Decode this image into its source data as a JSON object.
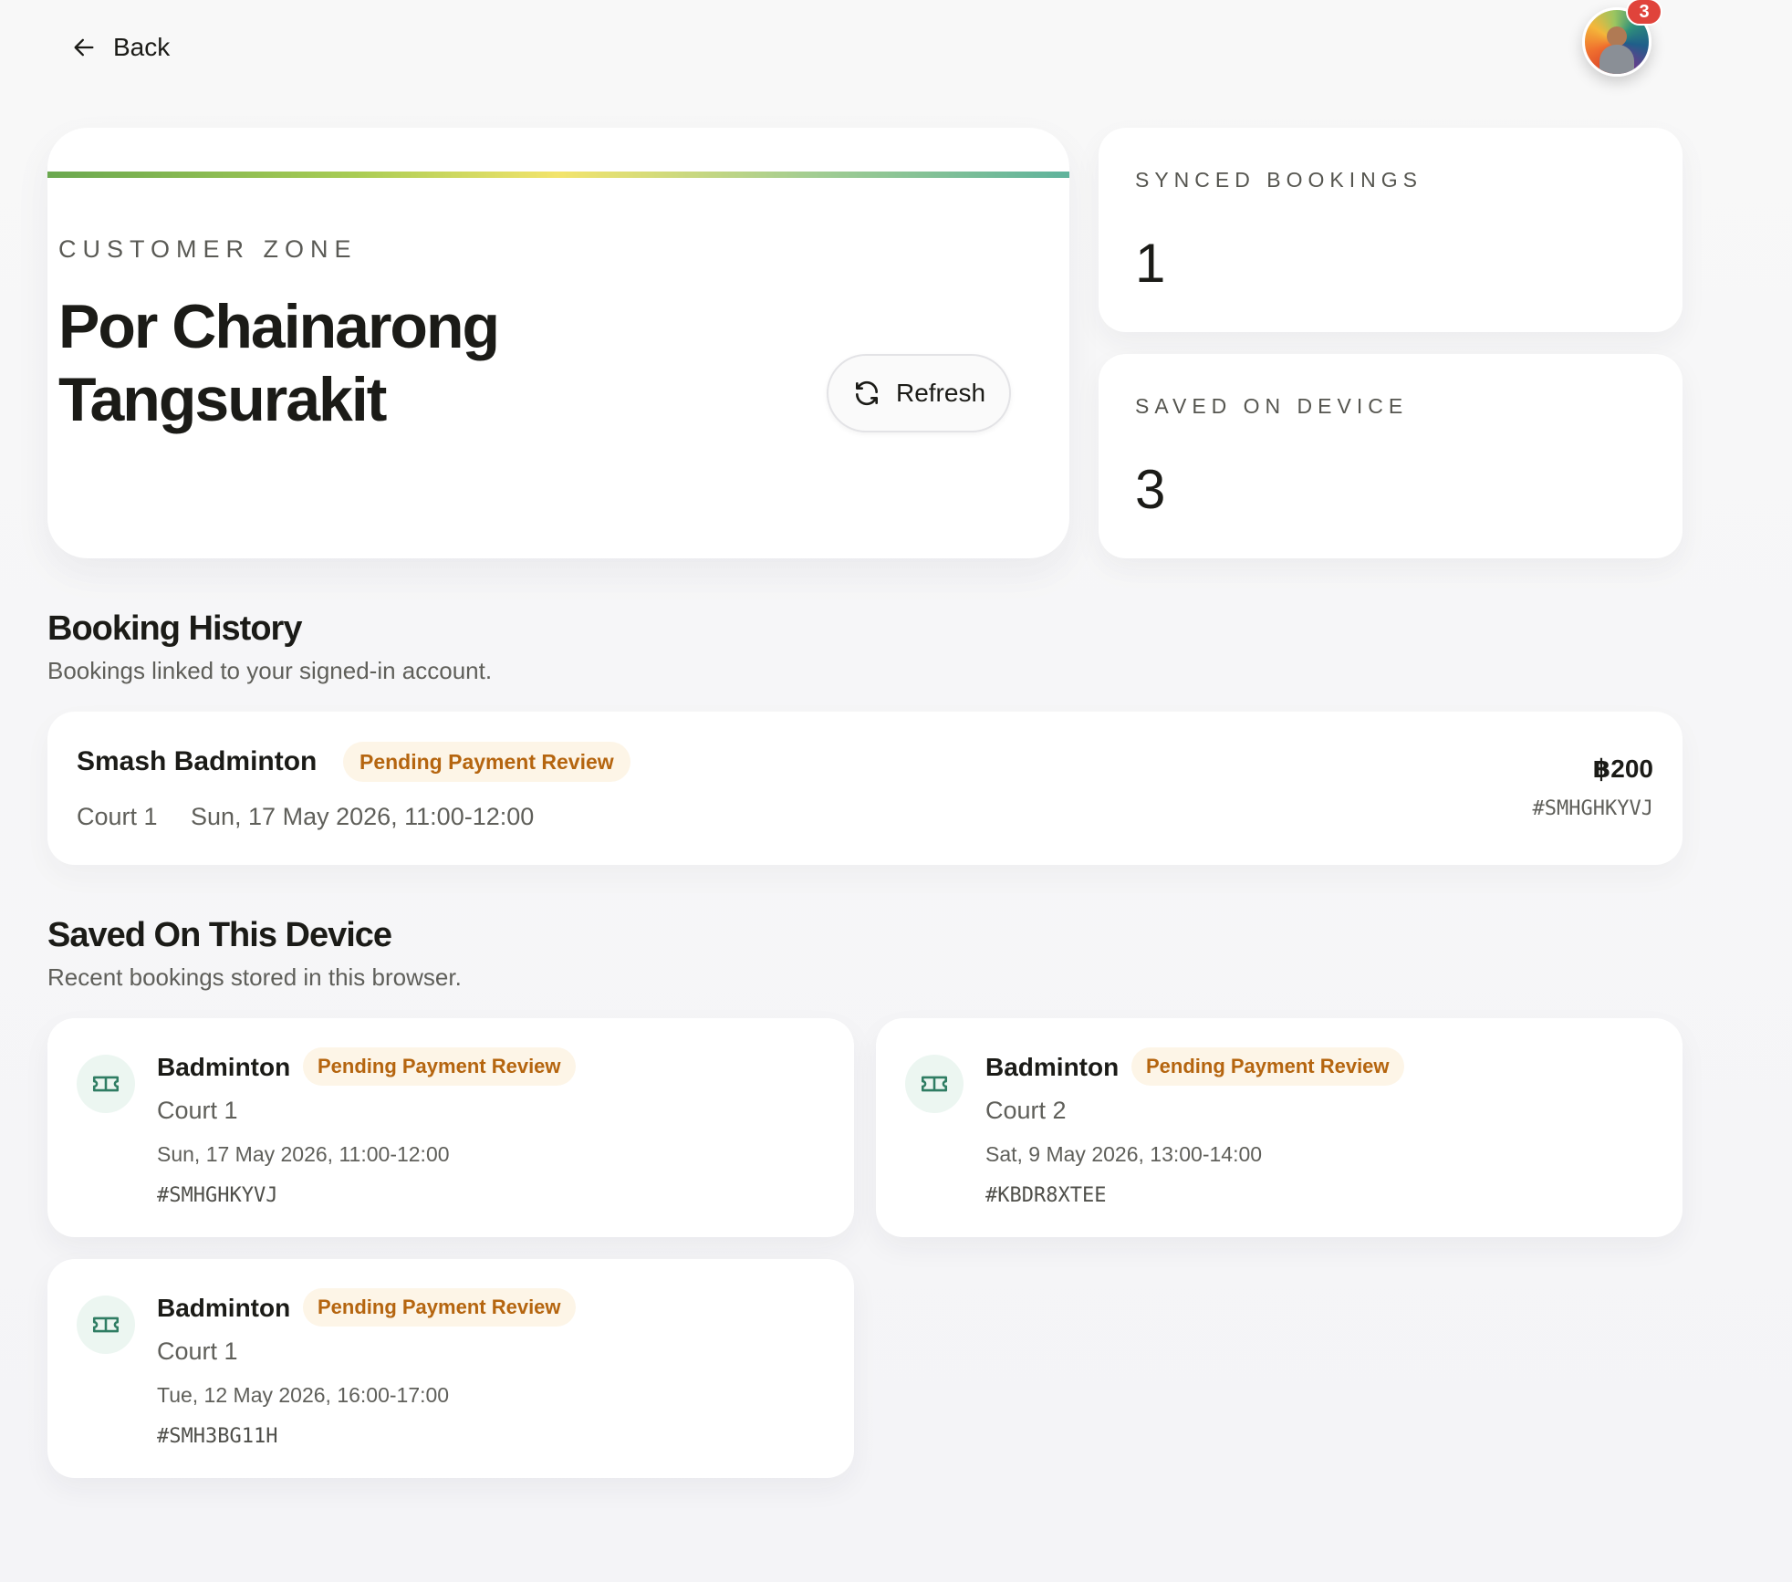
{
  "header": {
    "back_label": "Back",
    "notification_count": "3"
  },
  "hero": {
    "eyebrow": "CUSTOMER ZONE",
    "name": "Por Chainarong Tangsurakit",
    "refresh_label": "Refresh"
  },
  "stats": [
    {
      "label": "SYNCED BOOKINGS",
      "value": "1"
    },
    {
      "label": "SAVED ON DEVICE",
      "value": "3"
    }
  ],
  "history": {
    "title": "Booking History",
    "subtitle": "Bookings linked to your signed-in account.",
    "items": [
      {
        "venue": "Smash Badminton",
        "status": "Pending Payment Review",
        "court": "Court 1",
        "when": "Sun, 17 May 2026, 11:00-12:00",
        "price": "฿200",
        "code": "#SMHGHKYVJ"
      }
    ]
  },
  "saved": {
    "title": "Saved On This Device",
    "subtitle": "Recent bookings stored in this browser.",
    "items": [
      {
        "sport": "Badminton",
        "status": "Pending Payment Review",
        "court": "Court 1",
        "when": "Sun, 17 May 2026, 11:00-12:00",
        "code": "#SMHGHKYVJ",
        "icon": "ticket-icon"
      },
      {
        "sport": "Badminton",
        "status": "Pending Payment Review",
        "court": "Court 2",
        "when": "Sat, 9 May 2026, 13:00-14:00",
        "code": "#KBDR8XTEE",
        "icon": "ticket-icon"
      },
      {
        "sport": "Badminton",
        "status": "Pending Payment Review",
        "court": "Court 1",
        "when": "Tue, 12 May 2026, 16:00-17:00",
        "code": "#SMH3BG11H",
        "icon": "ticket-icon"
      }
    ]
  },
  "colors": {
    "status_pending_text": "#b5650f",
    "status_pending_bg": "#fdf5e7",
    "icon_accent": "#2f7d63",
    "badge": "#e0433b"
  }
}
